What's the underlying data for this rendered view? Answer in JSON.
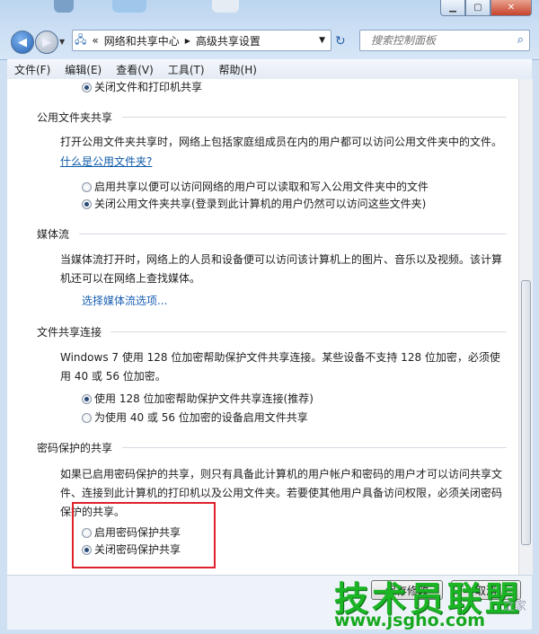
{
  "window": {
    "breadcrumb_prefix": "«",
    "breadcrumb": [
      "网络和共享中心",
      "高级共享设置"
    ],
    "search_placeholder": "搜索控制面板"
  },
  "menu": [
    "文件(F)",
    "编辑(E)",
    "查看(V)",
    "工具(T)",
    "帮助(H)"
  ],
  "top_option": "关闭文件和打印机共享",
  "public_folder": {
    "title": "公用文件夹共享",
    "desc": "打开公用文件夹共享时，网络上包括家庭组成员在内的用户都可以访问公用文件夹中的文件。",
    "link": "什么是公用文件夹?",
    "options": [
      "启用共享以便可以访问网络的用户可以读取和写入公用文件夹中的文件",
      "关闭公用文件夹共享(登录到此计算机的用户仍然可以访问这些文件夹)"
    ]
  },
  "media": {
    "title": "媒体流",
    "desc": "当媒体流打开时，网络上的人员和设备便可以访问该计算机上的图片、音乐以及视频。该计算机还可以在网络上查找媒体。",
    "link": "选择媒体流选项..."
  },
  "file_sharing": {
    "title": "文件共享连接",
    "desc": "Windows 7 使用 128 位加密帮助保护文件共享连接。某些设备不支持 128 位加密，必须使用 40 或 56 位加密。",
    "options": [
      "使用 128 位加密帮助保护文件共享连接(推荐)",
      "为使用 40 或 56 位加密的设备启用文件共享"
    ]
  },
  "password": {
    "title": "密码保护的共享",
    "desc": "如果已启用密码保护的共享，则只有具备此计算机的用户帐户和密码的用户才可以访问共享文件、连接到此计算机的打印机以及公用文件夹。若要使其他用户具备访问权限，必须关闭密码保护的共享。",
    "options": [
      "启用密码保护共享",
      "关闭密码保护共享"
    ]
  },
  "buttons": {
    "save": "保存修改",
    "cancel": "取消"
  },
  "watermark": {
    "main": "技术员联盟",
    "url": "www.jsgho.com",
    "side": "之家"
  }
}
